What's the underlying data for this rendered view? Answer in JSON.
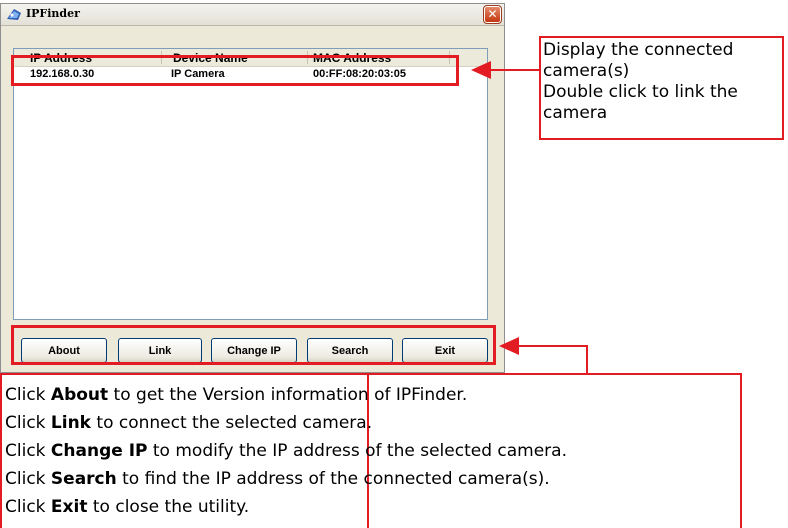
{
  "window": {
    "title": "IPFinder",
    "close_symbol": "✕"
  },
  "listview": {
    "columns": [
      "IP Address",
      "Device Name",
      "MAC Address"
    ],
    "rows": [
      {
        "ip": "192.168.0.30",
        "device": "IP Camera",
        "mac": "00:FF:08:20:03:05"
      }
    ]
  },
  "buttons": {
    "about": "About",
    "link": "Link",
    "change_ip": "Change IP",
    "search": "Search",
    "exit": "Exit"
  },
  "callout_top": {
    "line1": "Display the connected",
    "line2": "camera(s)",
    "line3": "Double click to link the",
    "line4": "camera"
  },
  "callout_bottom": {
    "prefix": "Click",
    "lines": [
      {
        "keyword": "About",
        "text": " to get the Version information of IPFinder."
      },
      {
        "keyword": "Link",
        "text": " to connect the selected camera."
      },
      {
        "keyword": "Change IP",
        "text": " to modify the IP address of the selected camera."
      },
      {
        "keyword": "Search",
        "text": " to find the IP address of the connected camera(s)."
      },
      {
        "keyword": "Exit",
        "text": " to close the utility."
      }
    ]
  },
  "colors": {
    "annotation_red": "#e31b23",
    "window_bg": "#ece9d8",
    "button_border": "#003c74"
  }
}
